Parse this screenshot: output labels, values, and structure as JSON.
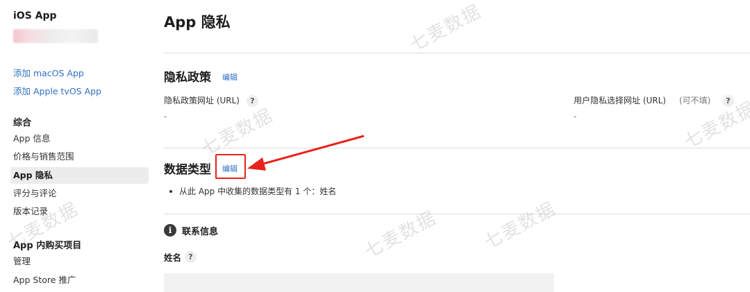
{
  "sidebar": {
    "app_title": "iOS App",
    "links": [
      "添加 macOS App",
      "添加 Apple tvOS App"
    ],
    "general_heading": "综合",
    "general_items": [
      {
        "label": "App 信息",
        "active": false
      },
      {
        "label": "价格与销售范围",
        "active": false
      },
      {
        "label": "App 隐私",
        "active": true
      },
      {
        "label": "评分与评论",
        "active": false
      },
      {
        "label": "版本记录",
        "active": false
      }
    ],
    "iap_heading": "App 内购买项目",
    "iap_items": [
      "管理",
      "App Store 推广"
    ]
  },
  "main": {
    "title": "App 隐私",
    "privacy_policy": {
      "title": "隐私政策",
      "edit": "编辑",
      "url_label": "隐私政策网址 (URL)",
      "url_value": "-",
      "choice_label": "用户隐私选择网址 (URL)",
      "choice_note": "(可不填)",
      "choice_value": "-"
    },
    "data_types": {
      "title": "数据类型",
      "edit": "编辑",
      "summary": "从此 App 中收集的数据类型有 1 个：姓名"
    },
    "contact": {
      "info_icon": "i",
      "title": "联系信息",
      "name_label": "姓名"
    },
    "help": "?"
  },
  "watermark": "七麦数据",
  "colors": {
    "link": "#2f6fc4",
    "annotation": "#e8211c",
    "active_bg": "#ececec"
  }
}
